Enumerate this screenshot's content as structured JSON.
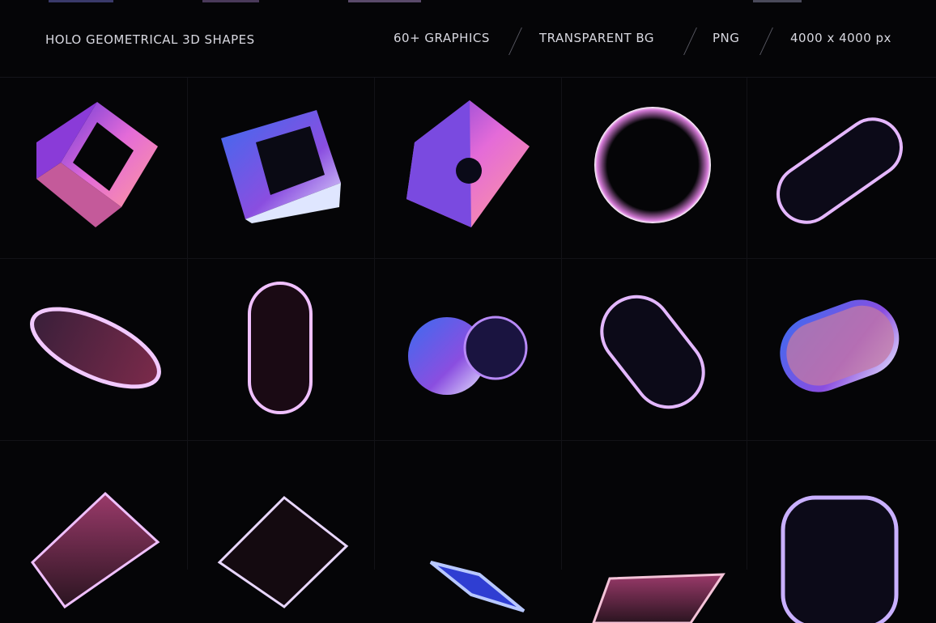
{
  "header": {
    "title": "HOLO GEOMETRICAL 3D SHAPES",
    "graphics_count": "60+ GRAPHICS",
    "background": "TRANSPARENT BG",
    "format": "PNG",
    "resolution": "4000 x 4000 px"
  },
  "colors": {
    "background": "#050507",
    "text": "#d8d8e0",
    "holo_pink": "#e46bd8",
    "holo_blue": "#3b6cf0",
    "holo_violet": "#8a4ee0"
  },
  "shapes": [
    {
      "name": "hollow-cube-icon"
    },
    {
      "name": "tilted-cube-icon"
    },
    {
      "name": "pyramid-cube-icon"
    },
    {
      "name": "ring-circle-icon"
    },
    {
      "name": "capsule-diagonal-icon"
    },
    {
      "name": "ellipse-disc-icon"
    },
    {
      "name": "capsule-vertical-icon"
    },
    {
      "name": "double-sphere-icon"
    },
    {
      "name": "capsule-tilted-icon"
    },
    {
      "name": "rounded-cylinder-icon"
    },
    {
      "name": "parallelogram-pink-icon"
    },
    {
      "name": "parallelogram-outline-icon"
    },
    {
      "name": "parallelogram-blue-icon"
    },
    {
      "name": "trapezoid-slab-icon"
    },
    {
      "name": "rounded-square-outline-icon"
    }
  ]
}
